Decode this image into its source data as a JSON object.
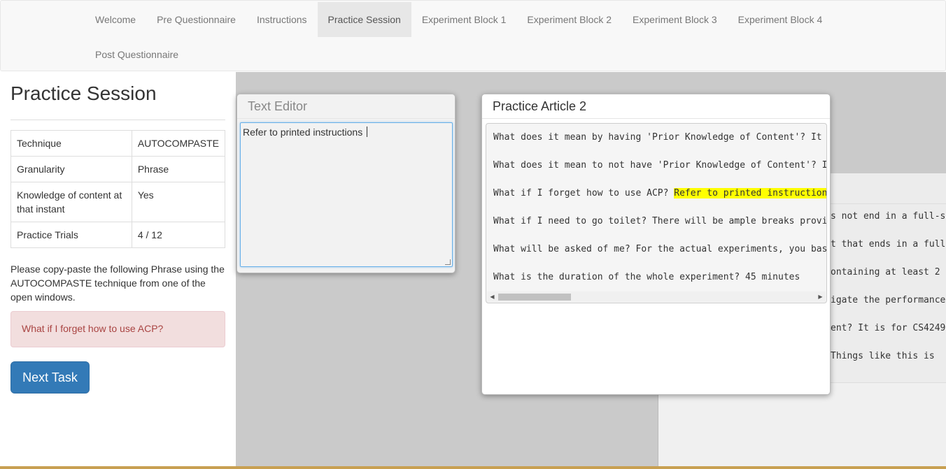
{
  "nav": {
    "items": [
      {
        "label": "Welcome"
      },
      {
        "label": "Pre Questionnaire"
      },
      {
        "label": "Instructions"
      },
      {
        "label": "Practice Session"
      },
      {
        "label": "Experiment Block 1"
      },
      {
        "label": "Experiment Block 2"
      },
      {
        "label": "Experiment Block 3"
      },
      {
        "label": "Experiment Block 4"
      },
      {
        "label": "Post Questionnaire"
      }
    ],
    "active": "Practice Session"
  },
  "sidebar": {
    "title": "Practice Session",
    "rows": [
      {
        "key": "Technique",
        "value": "AUTOCOMPASTE"
      },
      {
        "key": "Granularity",
        "value": "Phrase"
      },
      {
        "key": "Knowledge of content at that instant",
        "value": "Yes"
      },
      {
        "key": "Practice Trials",
        "value": "4 / 12"
      }
    ],
    "instruction": "Please copy-paste the following Phrase using the AUTOCOMPASTE technique from one of the open windows.",
    "target_phrase": "What if I forget how to use ACP?",
    "next_button": "Next Task"
  },
  "editor": {
    "title": "Text Editor",
    "content": "Refer to printed instructions "
  },
  "article": {
    "title": "Practice Article 2",
    "lines": {
      "l1": "What does it mean by having 'Prior Knowledge of Content'? It m",
      "l2": "What does it mean to not have 'Prior Knowledge of Content'? It",
      "l3_pre": "What if I forget how to use ACP? ",
      "l3_hl": "Refer to printed instructions",
      "l4": "What if I need to go toilet? There will be ample breaks provid",
      "l5": "What will be asked of me? For the actual experiments, you basi",
      "l6": "What is the duration of the whole experiment? 45 minutes"
    }
  },
  "background_window": {
    "lines": [
      "s not end in a full-s",
      "t that ends in a full",
      "ontaining at least 2",
      "igate the performance",
      "ent? It is for CS4249",
      " Things like this is"
    ]
  },
  "colors": {
    "primary_button": "#337ab7",
    "alert_bg": "#f2dede",
    "alert_text": "#a94442",
    "highlight": "#ffff00",
    "workspace": "#cacaca"
  }
}
